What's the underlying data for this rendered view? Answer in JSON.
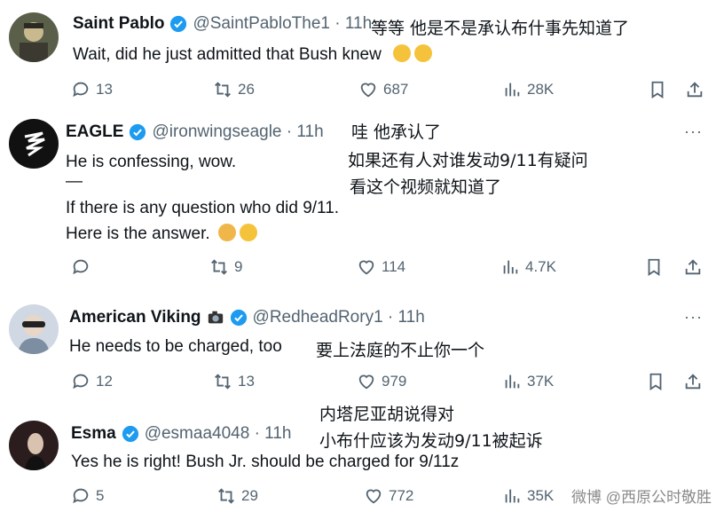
{
  "tweets": [
    {
      "name": "Saint Pablo",
      "handle": "@SaintPabloThe1 · 11h",
      "cn_annotation": "等等 他是不是承认布什事先知道了",
      "lines": [
        "Wait, did he just admitted that Bush knew"
      ],
      "actions": {
        "replies": "13",
        "retweets": "26",
        "likes": "687",
        "views": "28K"
      }
    },
    {
      "name": "EAGLE",
      "handle": "@ironwingseagle · 11h",
      "cn_annotation": [
        "哇 他承认了",
        "如果还有人对谁发动9/11有疑问",
        "看这个视频就知道了"
      ],
      "lines": [
        "He is confessing, wow.",
        "—",
        "If there is any question who did 9/11.",
        "Here is the answer."
      ],
      "more": "···",
      "actions": {
        "replies": "",
        "retweets": "9",
        "likes": "114",
        "views": "4.7K"
      }
    },
    {
      "name": "American Viking",
      "handle": "@RedheadRory1 · 11h",
      "cn_annotation": "要上法庭的不止你一个",
      "lines": [
        "He needs to be charged, too"
      ],
      "more": "···",
      "actions": {
        "replies": "12",
        "retweets": "13",
        "likes": "979",
        "views": "37K"
      }
    },
    {
      "name": "Esma",
      "handle": "@esmaa4048 · 11h",
      "cn_annotation": [
        "内塔尼亚胡说得对",
        "小布什应该为发动9/11被起诉"
      ],
      "lines": [
        "Yes he is right! Bush Jr. should be charged for 9/11z"
      ],
      "actions": {
        "replies": "5",
        "retweets": "29",
        "likes": "772",
        "views": "35K"
      }
    }
  ],
  "watermark": "微博 @西原公时敬胜",
  "colors": {
    "verified": "#1d9bf0",
    "muted": "#536471",
    "text": "#0f1419"
  }
}
